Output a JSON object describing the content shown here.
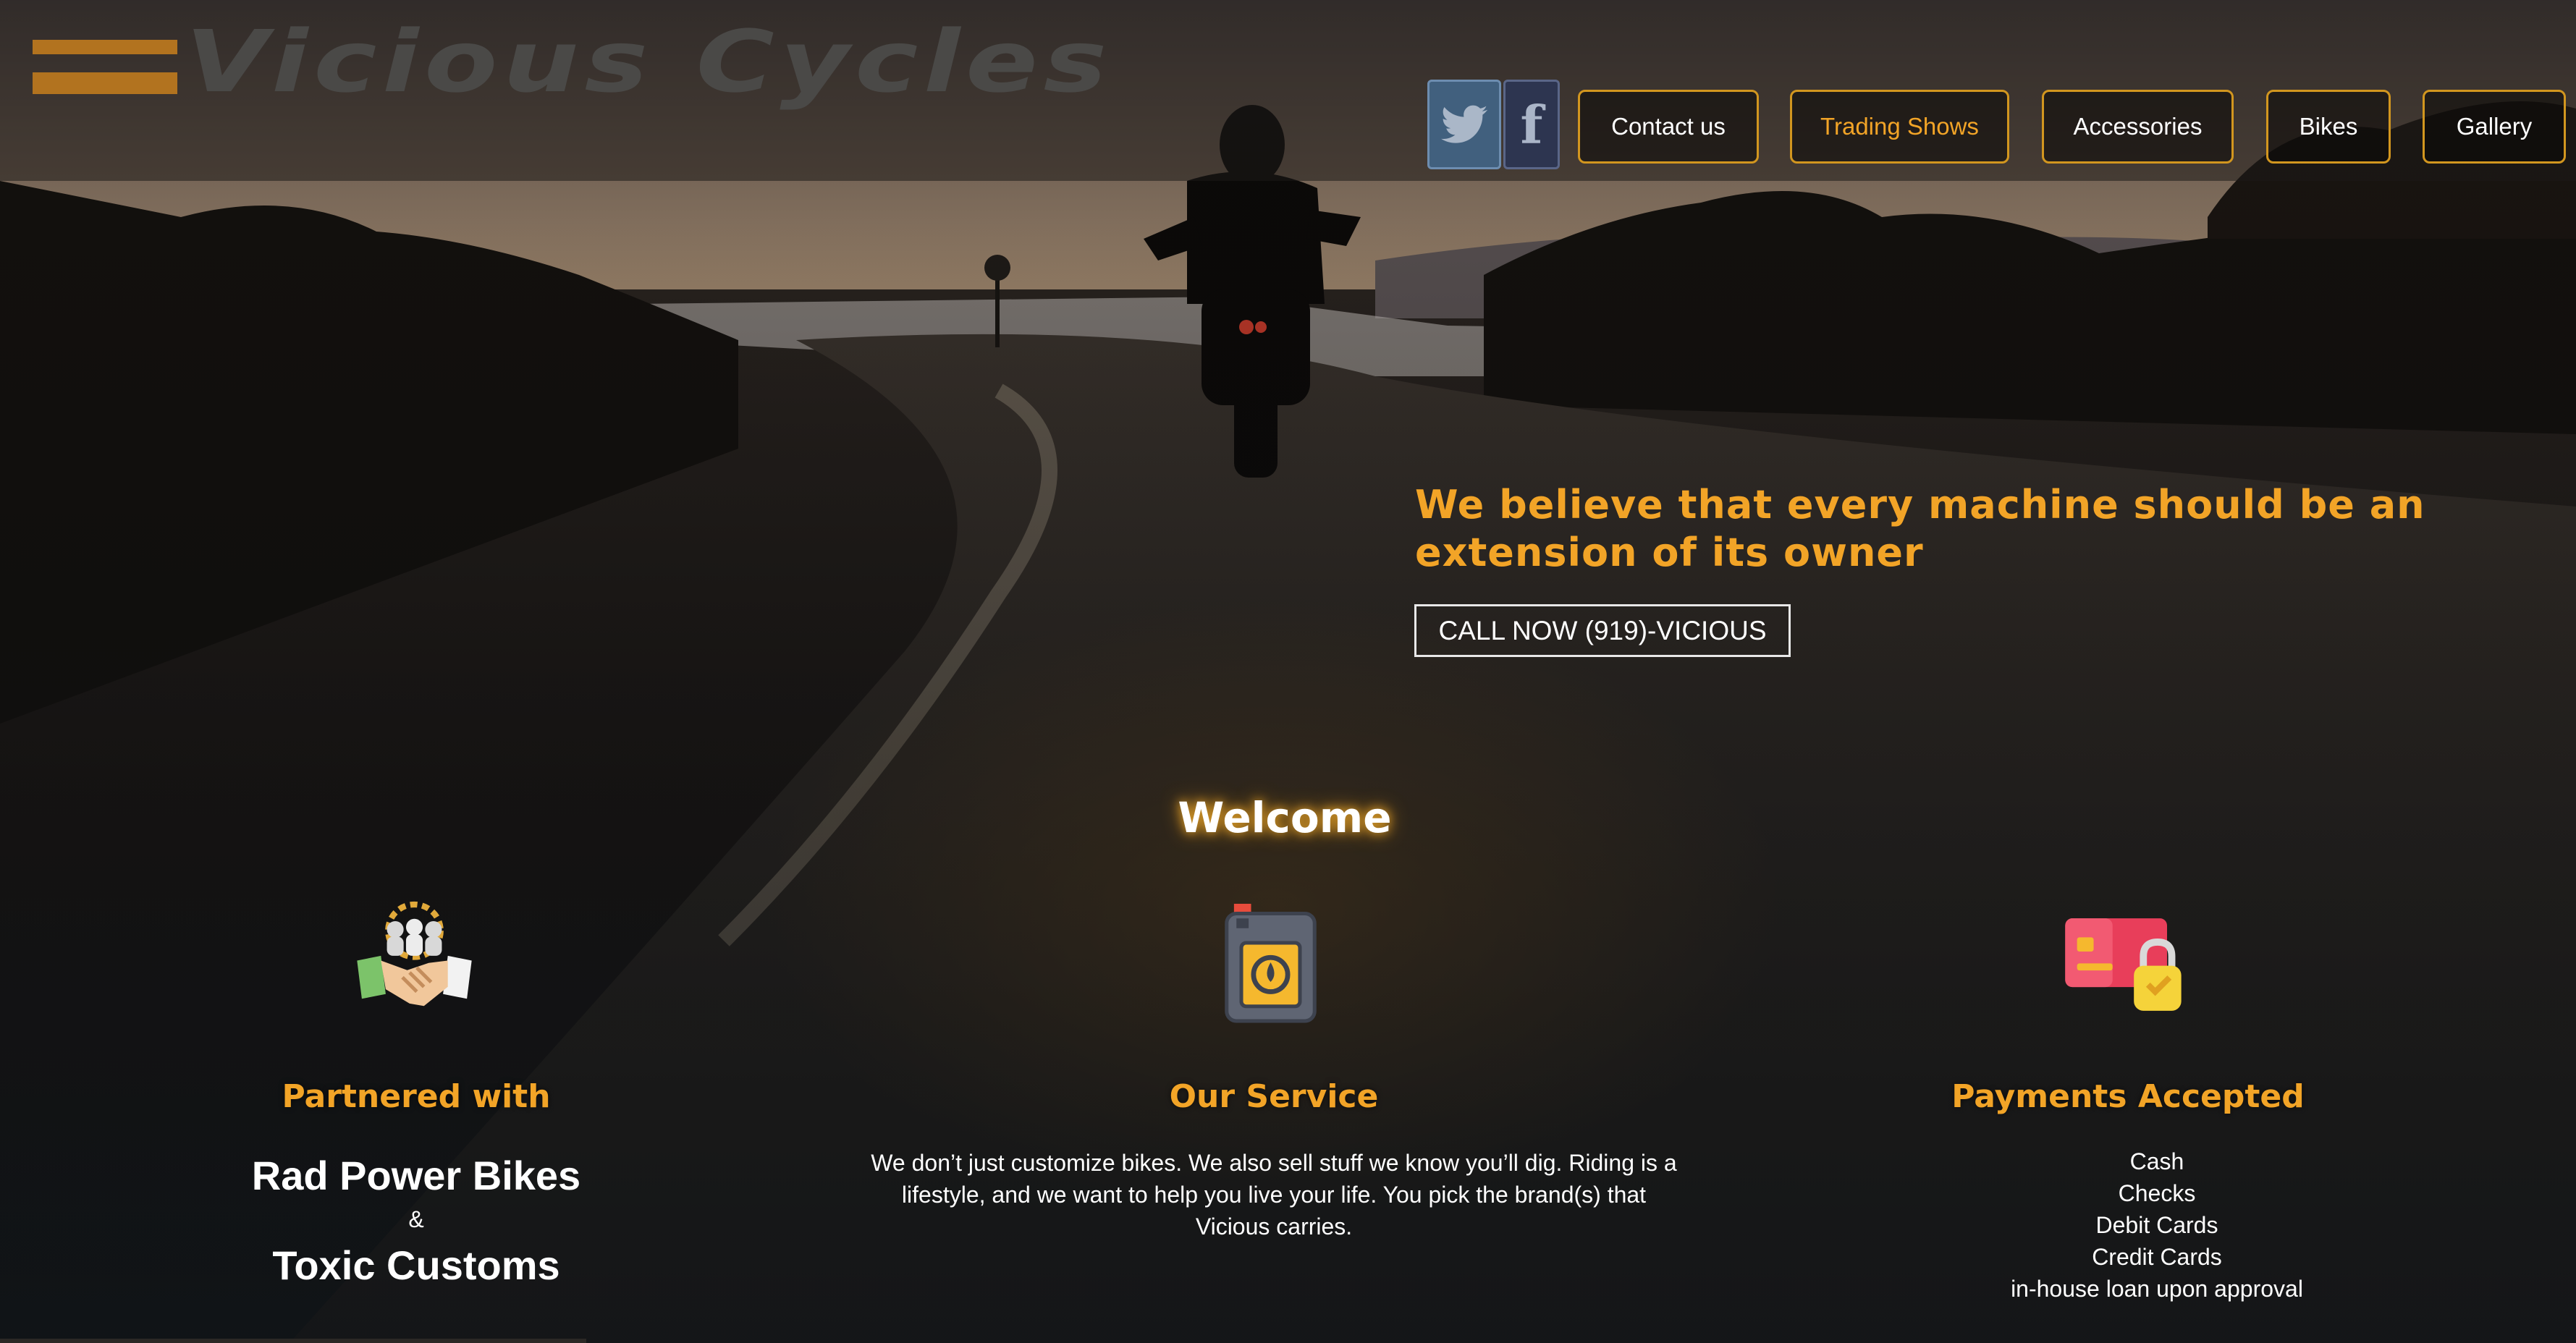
{
  "brand": {
    "logo_text": "Vicious Cycles",
    "accent_color": "#f2a427",
    "logo_color": "#b2731f"
  },
  "social": [
    {
      "name": "twitter",
      "glyph": "🐦"
    },
    {
      "name": "facebook",
      "glyph": "f"
    }
  ],
  "nav": {
    "contact": "Contact us",
    "trading": "Trading Shows",
    "accessories": "Accessories",
    "bikes": "Bikes",
    "gallery": "Gallery",
    "active": "Trading Shows"
  },
  "hero": {
    "tagline": "We believe that every machine should be an extension of its owner",
    "cta": "CALL NOW (919)-VICIOUS"
  },
  "welcome": "Welcome",
  "columns": {
    "partners": {
      "icon": "handshake-icon",
      "title": "Partnered with",
      "name1": "Rad Power Bikes",
      "amp": "&",
      "name2": "Toxic Customs"
    },
    "service": {
      "icon": "oil-can-icon",
      "title": "Our Service",
      "text": "We don’t just customize bikes. We also sell stuff we know you’ll dig. Riding is a lifestyle, and we want to help you live your life. You pick the brand(s) that Vicious carries."
    },
    "payments": {
      "icon": "secure-card-icon",
      "title": "Payments Accepted",
      "items": [
        "Cash",
        "Checks",
        "Debit Cards",
        "Credit Cards",
        "in-house loan upon approval"
      ]
    }
  }
}
